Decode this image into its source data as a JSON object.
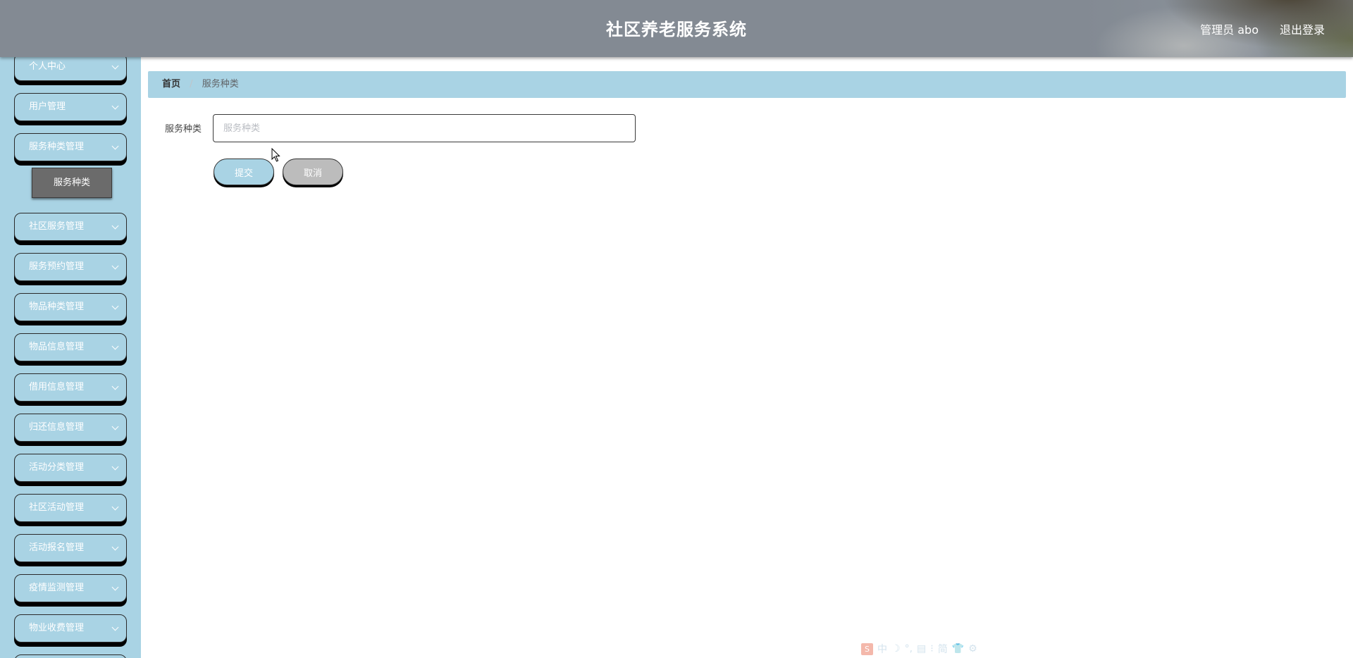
{
  "header": {
    "title": "社区养老服务系统",
    "user_label": "管理员 abo",
    "logout_label": "退出登录"
  },
  "sidebar": {
    "items": [
      {
        "label": "个人中心"
      },
      {
        "label": "用户管理"
      },
      {
        "label": "服务种类管理",
        "expanded": true,
        "children": [
          {
            "label": "服务种类",
            "active": true
          }
        ]
      },
      {
        "label": "社区服务管理"
      },
      {
        "label": "服务预约管理"
      },
      {
        "label": "物品种类管理"
      },
      {
        "label": "物品信息管理"
      },
      {
        "label": "借用信息管理"
      },
      {
        "label": "归还信息管理"
      },
      {
        "label": "活动分类管理"
      },
      {
        "label": "社区活动管理"
      },
      {
        "label": "活动报名管理"
      },
      {
        "label": "疫情监测管理"
      },
      {
        "label": "物业收费管理"
      }
    ]
  },
  "breadcrumb": {
    "home": "首页",
    "separator": "/",
    "current": "服务种类"
  },
  "form": {
    "field_label": "服务种类",
    "field_value": "",
    "field_placeholder": "服务种类",
    "submit_label": "提交",
    "cancel_label": "取消"
  },
  "ime": {
    "logo": "S",
    "mode": "中",
    "glyphs": [
      "☽",
      "°,",
      "▤",
      "⁝",
      "简",
      "👕",
      "⚙"
    ]
  },
  "colors": {
    "header_bg": "#838a93",
    "sidebar_bg": "#a9d3e4",
    "accent": "#a9d3e4",
    "active_submenu": "#6b6b6b",
    "cancel_button": "#bcbcbc"
  }
}
